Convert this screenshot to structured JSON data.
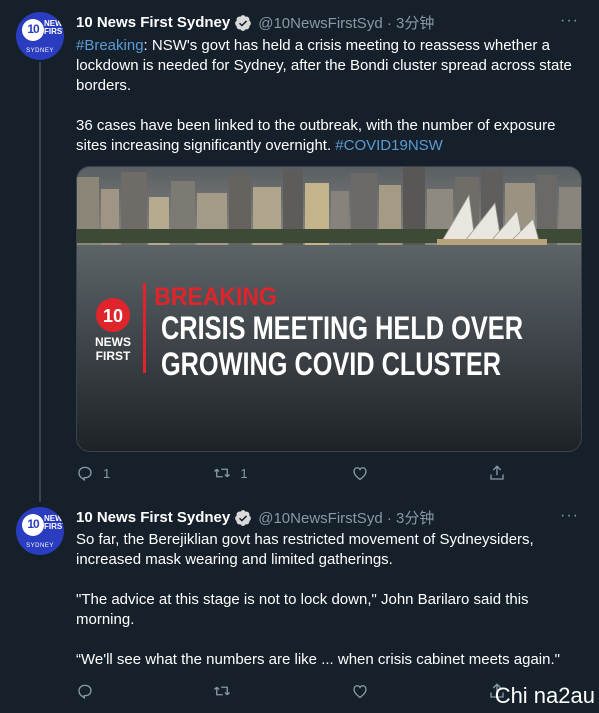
{
  "tweet1": {
    "name": "10 News First Sydney",
    "handle": "@10NewsFirstSyd · 3分钟",
    "more": "···",
    "hashtag_breaking": "#Breaking",
    "text_a": ": NSW's govt has held a crisis meeting to reassess whether a lockdown is needed for Sydney, after the Bondi cluster spread across state borders.",
    "text_b": "36 cases have been linked to the outbreak, with the number of exposure sites increasing significantly overnight. ",
    "hashtag_covid": "#COVID19NSW",
    "media": {
      "logo_ten": "10",
      "logo_news": "NEWS",
      "logo_first": "FIRST",
      "breaking": "BREAKING",
      "headline_1": "CRISIS MEETING HELD OVER",
      "headline_2": "GROWING COVID CLUSTER"
    },
    "replies": "1",
    "retweets": "1",
    "likes": "",
    "share": ""
  },
  "tweet2": {
    "name": "10 News First Sydney",
    "handle": "@10NewsFirstSyd · 3分钟",
    "more": "···",
    "para1": "So far, the Berejiklian govt has restricted movement of Sydneysiders, increased mask wearing and limited gatherings.",
    "para2": "\"The advice at this stage is not to lock down,\" John Barilaro said this morning.",
    "para3": "“We'll see what the numbers are like ... when crisis cabinet meets again.\""
  },
  "avatar": {
    "ten": "10",
    "news": "NEWS",
    "first": "FIRST",
    "sydney": "SYDNEY"
  },
  "watermark": "Chi na2au",
  "colors": {
    "background": "#15202b",
    "link": "#5b9bd5",
    "breaking_red": "#e0242b",
    "avatar_blue": "#2a3cbf",
    "verified": "#1da1f2"
  }
}
